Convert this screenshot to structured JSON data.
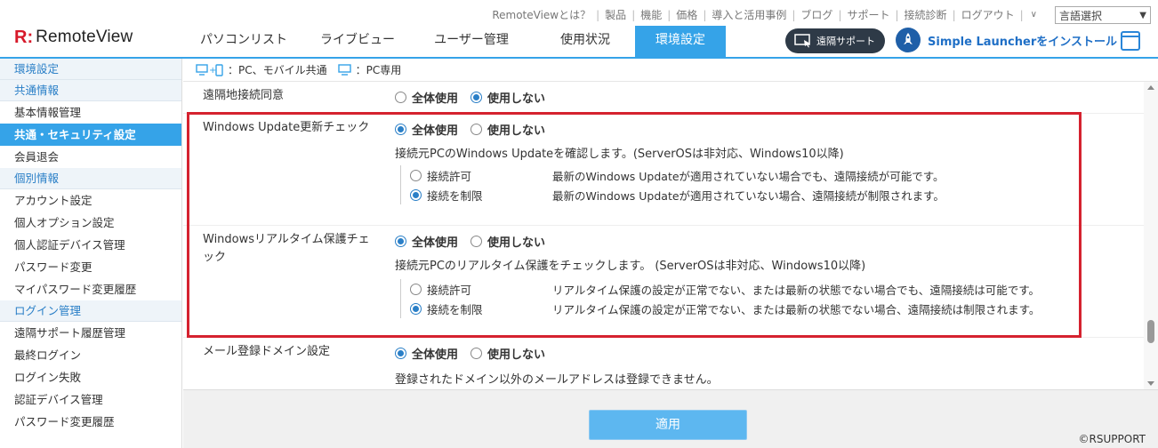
{
  "header": {
    "logo_mark": "R:",
    "logo_name": "RemoteView",
    "top_links": [
      "RemoteViewとは？",
      "製品",
      "機能",
      "価格",
      "導入と活用事例",
      "ブログ",
      "サポート",
      "接続診断",
      "ログアウト"
    ],
    "language_select": "言語選択",
    "tabs": [
      "パソコンリスト",
      "ライブビュー",
      "ユーザー管理",
      "使用状況",
      "環境設定"
    ],
    "active_tab": "環境設定",
    "remote_support_label": "遠隔サポート",
    "launcher_label": "Simple Launcherをインストール",
    "accent_color": "#35a3e8"
  },
  "sidebar": {
    "title": "環境設定",
    "sections": [
      {
        "head": "共通情報",
        "items": [
          "基本情報管理",
          "共通・セキュリティ設定",
          "会員退会"
        ]
      },
      {
        "head": "個別情報",
        "items": [
          "アカウント設定",
          "個人オプション設定",
          "個人認証デバイス管理",
          "パスワード変更",
          "マイパスワード変更履歴"
        ]
      },
      {
        "head": "ログイン管理",
        "items": [
          "遠隔サポート履歴管理",
          "最終ログイン",
          "ログイン失敗",
          "認証デバイス管理",
          "パスワード変更履歴"
        ]
      }
    ],
    "active_item": "共通・セキュリティ設定"
  },
  "legend": {
    "common": "：PC、モバイル共通",
    "pc_only": "：PC専用"
  },
  "settings": {
    "remote_consent": {
      "label": "遠隔地接続同意",
      "opt_all": "全体使用",
      "opt_none": "使用しない",
      "selected": "none"
    },
    "windows_update": {
      "label": "Windows Update更新チェック",
      "opt_all": "全体使用",
      "opt_none": "使用しない",
      "selected": "all",
      "desc": "接続元PCのWindows Updateを確認します。(ServerOSは非対応、Windows10以降)",
      "sub": [
        {
          "name": "接続許可",
          "text": "最新のWindows Updateが適用されていない場合でも、遠隔接続が可能です。",
          "selected": false
        },
        {
          "name": "接続を制限",
          "text": "最新のWindows Updateが適用されていない場合、遠隔接続が制限されます。",
          "selected": true
        }
      ]
    },
    "realtime": {
      "label_line1": "Windowsリアルタイム保護チェ",
      "label_line2": "ック",
      "opt_all": "全体使用",
      "opt_none": "使用しない",
      "selected": "all",
      "desc": "接続元PCのリアルタイム保護をチェックします。 (ServerOSは非対応、Windows10以降)",
      "sub": [
        {
          "name": "接続許可",
          "text": "リアルタイム保護の設定が正常でない、または最新の状態でない場合でも、遠隔接続は可能です。",
          "selected": false
        },
        {
          "name": "接続を制限",
          "text": "リアルタイム保護の設定が正常でない、または最新の状態でない場合、遠隔接続は制限されます。",
          "selected": true
        }
      ]
    },
    "mail_domain": {
      "label": "メール登録ドメイン設定",
      "opt_all": "全体使用",
      "opt_none": "使用しない",
      "selected": "all",
      "desc": "登録されたドメイン以外のメールアドレスは登録できません。"
    }
  },
  "footer": {
    "apply_label": "適用",
    "copyright": "©RSUPPORT"
  },
  "highlight_color": "#d5222f"
}
